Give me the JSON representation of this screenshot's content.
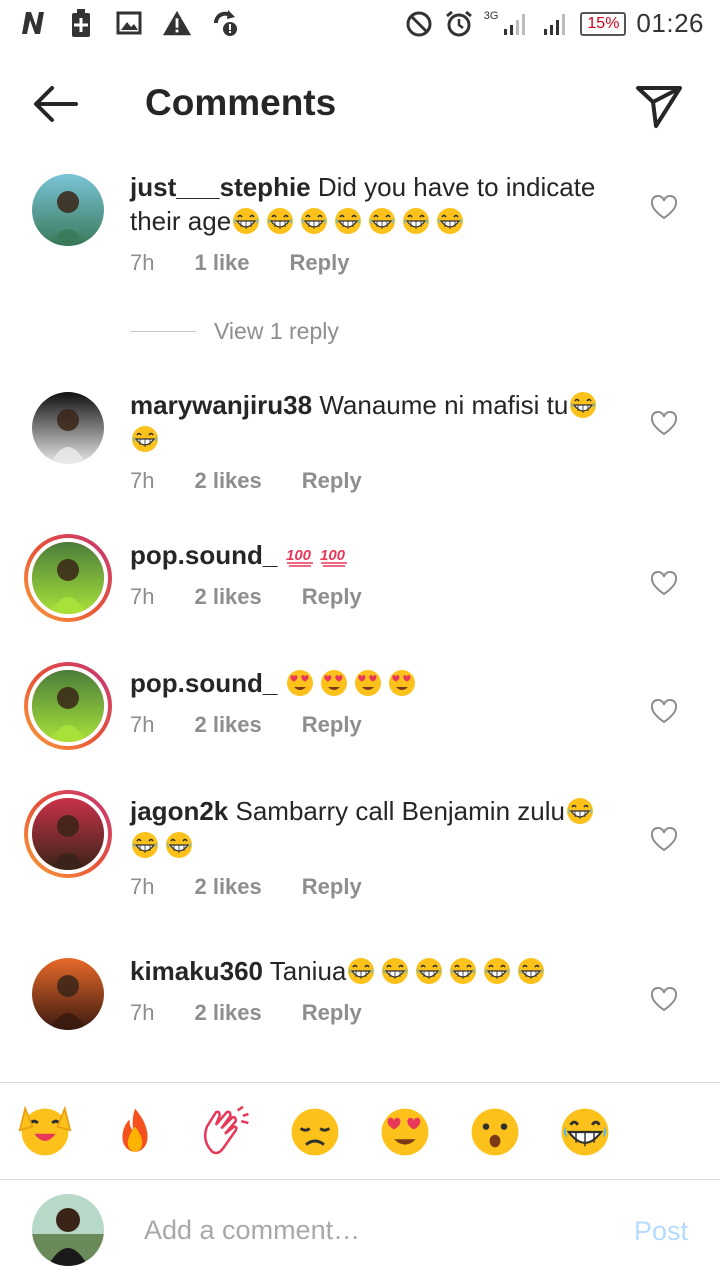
{
  "status_bar": {
    "time": "01:26",
    "battery": "15%",
    "network": "3G",
    "left_icons": [
      "netflix-n-icon",
      "battery-saver-icon",
      "image-icon",
      "warning-icon",
      "sync-icon"
    ],
    "right_icons": [
      "do-not-disturb-icon",
      "alarm-icon",
      "signal-icon",
      "signal-icon"
    ]
  },
  "header": {
    "title": "Comments"
  },
  "comments": [
    {
      "user": "just___stephie",
      "text": "Did you have to indicate their age",
      "emojis": 7,
      "emoji_type": "grin",
      "time": "7h",
      "likes": "1 like",
      "reply": "Reply",
      "avatar_colors": [
        "#7ac4d8",
        "#3a7a5a"
      ],
      "ring": false,
      "view_replies": "View 1 reply"
    },
    {
      "user": "marywanjiru38",
      "text": "Wanaume ni mafisi tu",
      "emojis": 2,
      "emoji_type": "grin",
      "time": "7h",
      "likes": "2 likes",
      "reply": "Reply",
      "avatar_colors": [
        "#111111",
        "#e8e8e8"
      ],
      "ring": false
    },
    {
      "user": "pop.sound_",
      "text": "",
      "emojis": 2,
      "emoji_type": "hundred",
      "time": "7h",
      "likes": "2 likes",
      "reply": "Reply",
      "avatar_colors": [
        "#4a7d3a",
        "#a8e23a"
      ],
      "ring": true
    },
    {
      "user": "pop.sound_",
      "text": "",
      "emojis": 4,
      "emoji_type": "heart-eyes",
      "time": "7h",
      "likes": "2 likes",
      "reply": "Reply",
      "avatar_colors": [
        "#4a7d3a",
        "#a8e23a"
      ],
      "ring": true
    },
    {
      "user": "jagon2k",
      "text": "Sambarry call Benjamin zulu",
      "emojis": 3,
      "emoji_type": "grin",
      "time": "7h",
      "likes": "2 likes",
      "reply": "Reply",
      "avatar_colors": [
        "#c8324a",
        "#3a2418"
      ],
      "ring": true
    },
    {
      "user": "kimaku360",
      "text": "Taniua",
      "emojis": 6,
      "emoji_type": "grin",
      "time": "7h",
      "likes": "2 likes",
      "reply": "Reply",
      "avatar_colors": [
        "#e86a2a",
        "#3a1a10"
      ],
      "ring": false
    }
  ],
  "emoji_bar": [
    "raising-hands",
    "fire",
    "clapping-hands",
    "sad-face",
    "heart-eyes",
    "surprised-face",
    "grin"
  ],
  "composer": {
    "placeholder": "Add a comment…",
    "post_label": "Post"
  }
}
